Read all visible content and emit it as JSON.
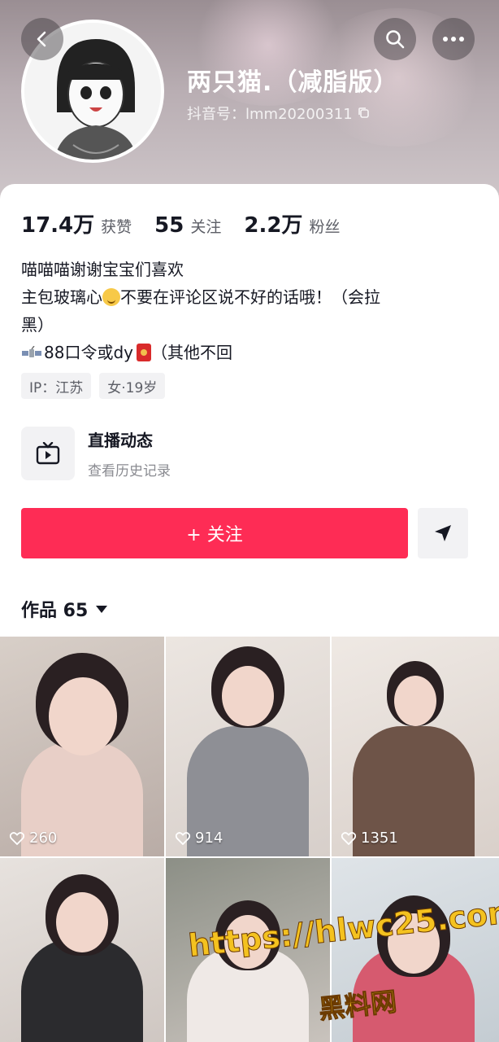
{
  "profile": {
    "nickname": "两只猫.（减脂版）",
    "douyin_id": "抖音号：lmm20200311"
  },
  "stats": [
    {
      "value": "17.4万",
      "label": "获赞"
    },
    {
      "value": "55",
      "label": "关注"
    },
    {
      "value": "2.2万",
      "label": "粉丝"
    }
  ],
  "bio": {
    "line1": "喵喵喵谢谢宝宝们喜欢",
    "line2a": "主包玻璃心",
    "line2b": "不要在评论区说不好的话哦！（会拉",
    "line3": "黑）",
    "line4a": "88口令或dy",
    "line4b": "（其他不回"
  },
  "tags": [
    "IP：江苏",
    "女·19岁"
  ],
  "live": {
    "title": "直播动态",
    "subtitle": "查看历史记录"
  },
  "actions": {
    "follow_label": "+ 关注"
  },
  "works": {
    "label": "作品 65"
  },
  "videos": [
    {
      "likes": "260"
    },
    {
      "likes": "914"
    },
    {
      "likes": "1351"
    },
    {
      "likes": ""
    },
    {
      "likes": ""
    },
    {
      "likes": ""
    }
  ],
  "watermark": {
    "url": "https://hlwc25.com",
    "text": "黑料网"
  },
  "colors": {
    "follow": "#fe2c55",
    "text": "#161823",
    "secondary": "#5c5e66"
  }
}
